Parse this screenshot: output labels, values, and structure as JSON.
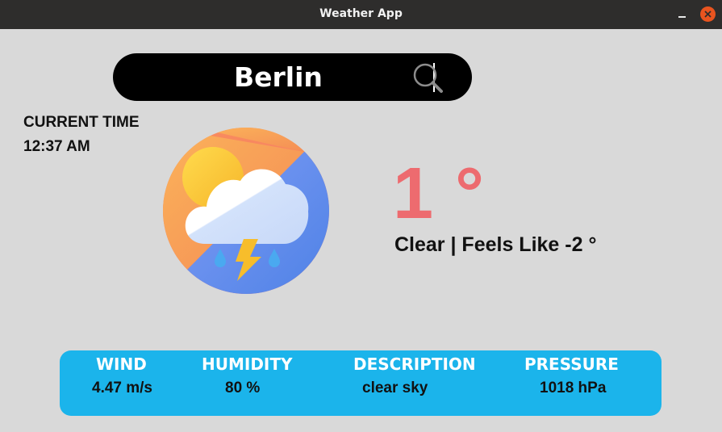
{
  "window": {
    "title": "Weather App"
  },
  "search": {
    "value": "Berlin",
    "icon": "search-icon"
  },
  "time": {
    "label": "CURRENT TIME",
    "value": "12:37 AM"
  },
  "weather_icon": "cloud-sun-lightning-rain-icon",
  "current": {
    "temperature": "1 °",
    "summary": "Clear | Feels Like -2 °"
  },
  "stats": {
    "wind": {
      "label": "WIND",
      "value": "4.47 m/s"
    },
    "humidity": {
      "label": "HUMIDITY",
      "value": "80 %"
    },
    "description": {
      "label": "DESCRIPTION",
      "value": "clear sky"
    },
    "pressure": {
      "label": "PRESSURE",
      "value": "1018 hPa"
    }
  },
  "colors": {
    "background": "#d9d9d9",
    "titlebar": "#2e2d2c",
    "close_button": "#e9541f",
    "search_bar": "#000000",
    "temperature": "#ed6b6f",
    "panel": "#1bb4eb"
  }
}
